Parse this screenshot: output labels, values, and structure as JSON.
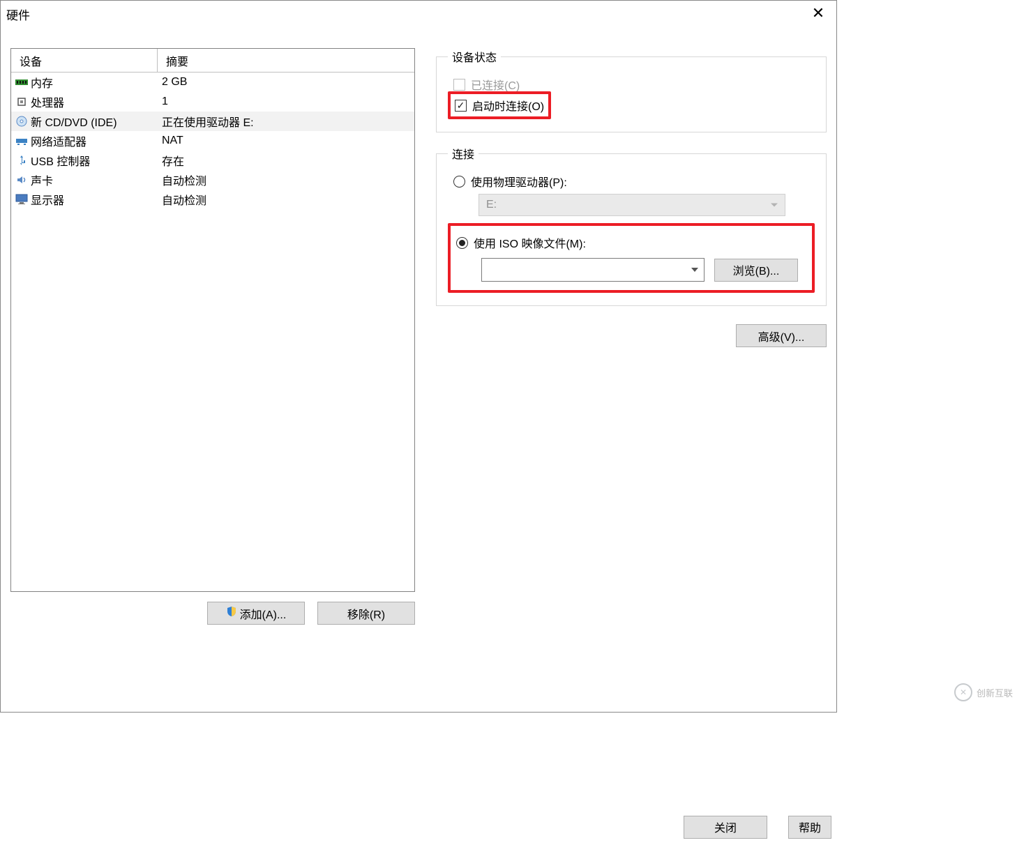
{
  "window": {
    "title": "硬件"
  },
  "deviceList": {
    "headers": {
      "device": "设备",
      "summary": "摘要"
    },
    "rows": [
      {
        "icon": "memory-icon",
        "name": "内存",
        "summary": "2 GB",
        "selected": false
      },
      {
        "icon": "cpu-icon",
        "name": "处理器",
        "summary": "1",
        "selected": false
      },
      {
        "icon": "cd-icon",
        "name": "新 CD/DVD (IDE)",
        "summary": "正在使用驱动器 E:",
        "selected": true
      },
      {
        "icon": "network-icon",
        "name": "网络适配器",
        "summary": "NAT",
        "selected": false
      },
      {
        "icon": "usb-icon",
        "name": "USB 控制器",
        "summary": "存在",
        "selected": false
      },
      {
        "icon": "sound-icon",
        "name": "声卡",
        "summary": "自动检测",
        "selected": false
      },
      {
        "icon": "display-icon",
        "name": "显示器",
        "summary": "自动检测",
        "selected": false
      }
    ]
  },
  "buttons": {
    "add": "添加(A)...",
    "remove": "移除(R)",
    "browse": "浏览(B)...",
    "advanced": "高级(V)...",
    "close": "关闭",
    "help": "帮助"
  },
  "deviceStatus": {
    "legend": "设备状态",
    "connected": {
      "label": "已连接(C)",
      "checked": false,
      "disabled": true
    },
    "connectAtPowerOn": {
      "label": "启动时连接(O)",
      "checked": true
    }
  },
  "connection": {
    "legend": "连接",
    "physical": {
      "label": "使用物理驱动器(P):",
      "selected": false,
      "driveValue": "E:"
    },
    "iso": {
      "label": "使用 ISO 映像文件(M):",
      "selected": true,
      "pathValue": ""
    }
  },
  "watermark": {
    "text": "创新互联",
    "sub": ""
  }
}
